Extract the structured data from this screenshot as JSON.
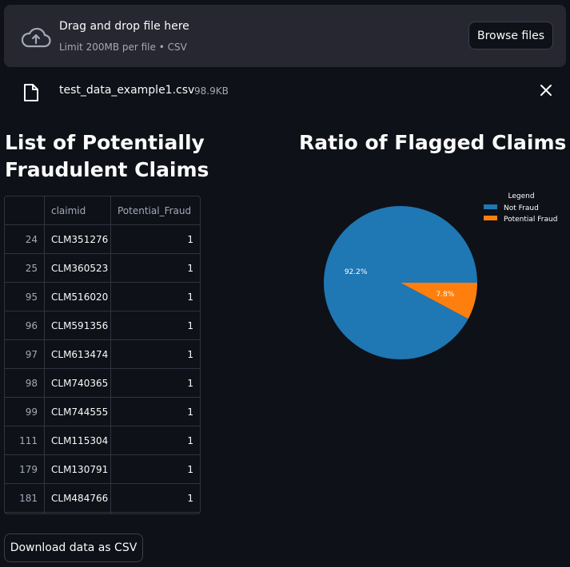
{
  "uploader": {
    "title": "Drag and drop file here",
    "limit": "Limit 200MB per file • CSV",
    "browse_label": "Browse files"
  },
  "uploaded_file": {
    "name": "test_data_example1.csv",
    "size": "98.9KB"
  },
  "left_section": {
    "title": "List of Potentially Fraudulent Claims"
  },
  "right_section": {
    "title": "Ratio of Flagged Claims"
  },
  "table": {
    "columns": [
      "",
      "claimid",
      "Potential_Fraud"
    ],
    "rows": [
      {
        "index": "24",
        "claimid": "CLM351276",
        "fraud": "1"
      },
      {
        "index": "25",
        "claimid": "CLM360523",
        "fraud": "1"
      },
      {
        "index": "95",
        "claimid": "CLM516020",
        "fraud": "1"
      },
      {
        "index": "96",
        "claimid": "CLM591356",
        "fraud": "1"
      },
      {
        "index": "97",
        "claimid": "CLM613474",
        "fraud": "1"
      },
      {
        "index": "98",
        "claimid": "CLM740365",
        "fraud": "1"
      },
      {
        "index": "99",
        "claimid": "CLM744555",
        "fraud": "1"
      },
      {
        "index": "111",
        "claimid": "CLM115304",
        "fraud": "1"
      },
      {
        "index": "179",
        "claimid": "CLM130791",
        "fraud": "1"
      },
      {
        "index": "181",
        "claimid": "CLM484766",
        "fraud": "1"
      }
    ]
  },
  "chart_data": {
    "type": "pie",
    "title": "",
    "legend_title": "Legend",
    "legend_position": "top-right",
    "categories": [
      "Not Fraud",
      "Potential Fraud"
    ],
    "values": [
      92.2,
      7.8
    ],
    "labels": [
      "92.2%",
      "7.8%"
    ],
    "colors": [
      "#1f77b4",
      "#ff7f0e"
    ]
  },
  "download_label": "Download data as CSV",
  "icons": {
    "upload": "cloud-upload-icon",
    "file": "file-icon",
    "close": "close-icon"
  }
}
